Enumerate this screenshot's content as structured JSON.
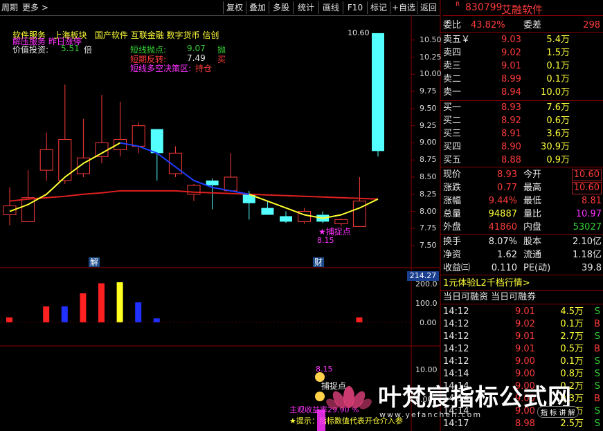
{
  "toolbar": {
    "left_title": "周期",
    "more": "更多 >",
    "buttons": [
      "复权",
      "叠加",
      "多股",
      "统计",
      "画线",
      "F10",
      "标记",
      "+自选",
      "返回"
    ]
  },
  "annotations": {
    "sectors": "软件服务   上海板块   国产软件 互联金融 数字货币 信创",
    "overlap_text": "解压服务 昨日涨停",
    "value_label": "价值投资:",
    "value_num": "5.51",
    "value_unit": "倍",
    "short_sell_label": "短线抛点:",
    "short_sell_val": "9.07",
    "short_sell_sig": "抛",
    "short_rev_label": "短期反转:",
    "short_rev_val": "7.49",
    "short_rev_sig": "买",
    "strategy_label": "短线多空决策区:",
    "strategy_val": "持仓",
    "catch_point": "★捕捉点",
    "catch_val": "8.15",
    "high_val": "10.60",
    "jie": "解",
    "cai": "财",
    "ind_box": "214.27"
  },
  "price_axis": [
    "10.50",
    "10.25",
    "10.00",
    "9.75",
    "9.50",
    "9.25",
    "9.00",
    "8.75",
    "8.50",
    "8.25",
    "8.00",
    "7.75",
    "7.50"
  ],
  "vol_axis": [
    "200.0",
    "100.0",
    "0.00"
  ],
  "bottom_axis": [
    "10.00"
  ],
  "chart_data": {
    "type": "candlestick",
    "ylim": [
      7.4,
      10.7
    ],
    "candles": [
      {
        "o": 8.08,
        "c": 7.95,
        "h": 8.35,
        "l": 7.8
      },
      {
        "o": 8.2,
        "c": 7.85,
        "h": 8.6,
        "l": 7.85
      },
      {
        "o": 8.9,
        "c": 8.6,
        "h": 9.15,
        "l": 8.45
      },
      {
        "o": 9.05,
        "c": 8.45,
        "h": 9.85,
        "l": 8.4
      },
      {
        "o": 8.78,
        "c": 8.55,
        "h": 9.35,
        "l": 8.5
      },
      {
        "o": 9.0,
        "c": 8.8,
        "h": 9.7,
        "l": 8.7
      },
      {
        "o": 9.05,
        "c": 8.9,
        "h": 9.6,
        "l": 8.8
      },
      {
        "o": 9.25,
        "c": 8.95,
        "h": 9.3,
        "l": 8.85
      },
      {
        "o": 8.85,
        "c": 9.2,
        "h": 9.2,
        "l": 8.45,
        "cyan": true
      },
      {
        "o": 8.85,
        "c": 8.55,
        "h": 8.95,
        "l": 8.5
      },
      {
        "o": 8.38,
        "c": 8.25,
        "h": 8.4,
        "l": 8.15
      },
      {
        "o": 8.45,
        "c": 8.38,
        "h": 8.48,
        "l": 8.03,
        "cyan": true
      },
      {
        "o": 8.5,
        "c": 8.3,
        "h": 8.85,
        "l": 8.3
      },
      {
        "o": 8.25,
        "c": 8.12,
        "h": 8.3,
        "l": 7.88,
        "cyan": true
      },
      {
        "o": 8.05,
        "c": 7.95,
        "h": 8.15,
        "l": 7.95,
        "cyan": true
      },
      {
        "o": 7.93,
        "c": 7.85,
        "h": 8.0,
        "l": 7.83,
        "cyan": true
      },
      {
        "o": 8.0,
        "c": 7.85,
        "h": 8.05,
        "l": 7.82
      },
      {
        "o": 7.95,
        "c": 7.85,
        "h": 8.0,
        "l": 7.83,
        "cyan": true
      },
      {
        "o": 7.88,
        "c": 7.82,
        "h": 7.9,
        "l": 7.78
      },
      {
        "o": 8.15,
        "c": 7.78,
        "h": 8.5,
        "l": 7.78
      },
      {
        "o": 10.6,
        "c": 8.88,
        "h": 10.6,
        "l": 8.8,
        "cyan": true
      }
    ],
    "volumes": [
      {
        "v": 25,
        "color": "red"
      },
      {
        "v": 0,
        "color": "none"
      },
      {
        "v": 80,
        "color": "red"
      },
      {
        "v": 80,
        "color": "blue"
      },
      {
        "v": 145,
        "color": "red"
      },
      {
        "v": 195,
        "color": "red"
      },
      {
        "v": 200,
        "color": "yellow"
      },
      {
        "v": 100,
        "color": "blue"
      },
      {
        "v": 20,
        "color": "blue"
      },
      {
        "v": 0,
        "color": "none"
      },
      {
        "v": 0,
        "color": "none"
      },
      {
        "v": 0,
        "color": "none"
      },
      {
        "v": 0,
        "color": "none"
      },
      {
        "v": 0,
        "color": "none"
      },
      {
        "v": 0,
        "color": "none"
      },
      {
        "v": 0,
        "color": "none"
      },
      {
        "v": 0,
        "color": "none"
      },
      {
        "v": 0,
        "color": "none"
      },
      {
        "v": 0,
        "color": "none"
      },
      {
        "v": 25,
        "color": "red"
      }
    ],
    "ma_yellow": [
      8.0,
      8.1,
      8.25,
      8.5,
      8.7,
      8.85,
      9.0,
      8.95,
      8.85,
      8.65,
      8.45,
      8.35,
      8.3,
      8.25,
      8.15,
      8.05,
      7.95,
      7.9,
      7.95,
      8.05,
      8.18
    ],
    "ma_red": [
      8.15,
      8.18,
      8.2,
      8.22,
      8.25,
      8.27,
      8.3,
      8.3,
      8.3,
      8.3,
      8.28,
      8.27,
      8.26,
      8.25,
      8.24,
      8.23,
      8.22,
      8.21,
      8.2,
      8.19,
      8.18
    ]
  },
  "quote": {
    "code": "830799",
    "name": "艾融软件",
    "r_mark": "R",
    "weibi_label": "委比",
    "weibi_val": "43.82%",
    "weicha_label": "委差",
    "weicha_val": "298",
    "asks": [
      {
        "label": "卖五￥",
        "price": "9.03",
        "vol": "5.4万"
      },
      {
        "label": "卖四",
        "price": "9.02",
        "vol": "1.5万"
      },
      {
        "label": "卖三",
        "price": "9.01",
        "vol": "0.1万"
      },
      {
        "label": "卖二",
        "price": "8.99",
        "vol": "0.1万"
      },
      {
        "label": "卖一",
        "price": "8.94",
        "vol": "10.0万"
      }
    ],
    "bids": [
      {
        "label": "买一",
        "price": "8.93",
        "vol": "7.6万"
      },
      {
        "label": "买二",
        "price": "8.92",
        "vol": "0.6万"
      },
      {
        "label": "买三",
        "price": "8.91",
        "vol": "3.6万"
      },
      {
        "label": "买四",
        "price": "8.90",
        "vol": "30.9万"
      },
      {
        "label": "买五",
        "price": "8.88",
        "vol": "0.9万"
      }
    ],
    "stats": [
      {
        "l1": "现价",
        "v1": "8.93",
        "c1": "red",
        "l2": "今开",
        "v2": "10.60",
        "c2": "red",
        "box": true
      },
      {
        "l1": "涨跌",
        "v1": "0.77",
        "c1": "red",
        "l2": "最高",
        "v2": "10.60",
        "c2": "red",
        "box": true
      },
      {
        "l1": "涨幅",
        "v1": "9.44%",
        "c1": "red",
        "l2": "最低",
        "v2": "8.81",
        "c2": "red"
      },
      {
        "l1": "总量",
        "v1": "94887",
        "c1": "yel",
        "l2": "量比",
        "v2": "10.97",
        "c2": "mag"
      },
      {
        "l1": "外盘",
        "v1": "41860",
        "c1": "red",
        "l2": "内盘",
        "v2": "53027",
        "c2": "grn"
      }
    ],
    "stats2": [
      {
        "l1": "换手",
        "v1": "8.07%",
        "l2": "股本",
        "v2": "2.10亿"
      },
      {
        "l1": "净资",
        "v1": "1.62",
        "l2": "流通",
        "v2": "1.18亿"
      },
      {
        "l1": "收益㈢",
        "v1": "0.110",
        "l2": "PE(动)",
        "v2": "39.8"
      }
    ],
    "l2_promo": "1元体验L2千档行情>",
    "margin": "当日可融资 当日可融券",
    "ticks": [
      {
        "t": "14:12",
        "p": "9.01",
        "v": "4.5万",
        "s": "S"
      },
      {
        "t": "14:12",
        "p": "9.02",
        "v": "0.1万",
        "s": "B"
      },
      {
        "t": "14:12",
        "p": "9.01",
        "v": "2.7万",
        "s": "S"
      },
      {
        "t": "14:12",
        "p": "9.01",
        "v": "0.5万",
        "s": "B"
      },
      {
        "t": "14:12",
        "p": "9.00",
        "v": "0.1万",
        "s": "S"
      },
      {
        "t": "14:14",
        "p": "9.00",
        "v": "0.8万",
        "s": "S"
      },
      {
        "t": "14:14",
        "p": "9.00",
        "v": "0.2万",
        "s": "S"
      },
      {
        "t": "14:14",
        "p": "9.00",
        "v": "0.3万",
        "s": "B"
      },
      {
        "t": "14:14",
        "p": "9.00",
        "v": "2.4万",
        "s": "S"
      },
      {
        "t": "14:17",
        "p": "8.98",
        "v": "2.5万",
        "s": "S"
      }
    ]
  },
  "bottom_text": {
    "val": "8.15",
    "catch": "捕捉点",
    "profit": "主观收益率29.90 %",
    "tip": "★提示：指标数值代表开仓介入参",
    "zero_label": "0.00"
  },
  "watermark": {
    "cn": "叶梵宸指标公式网",
    "url": "www.yefanchen.com",
    "sub": "指 标 讲 解"
  }
}
